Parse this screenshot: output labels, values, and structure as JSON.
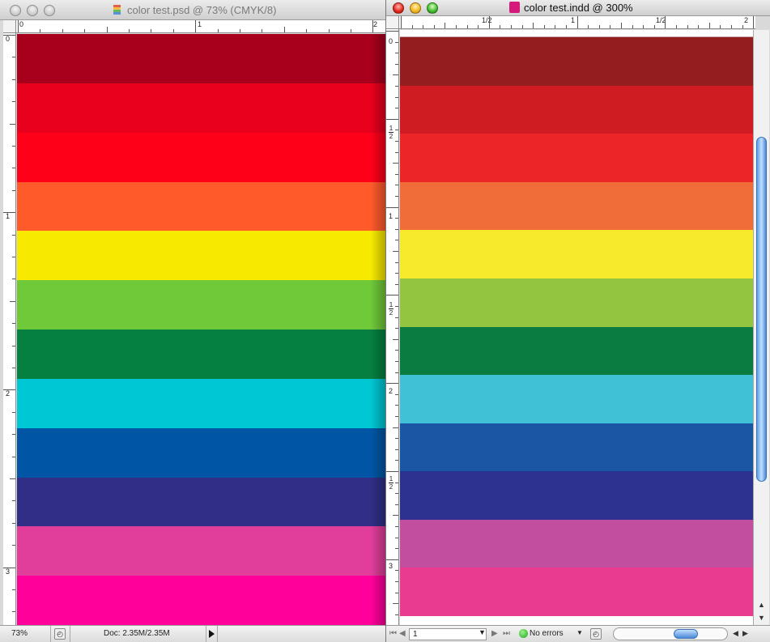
{
  "left_window": {
    "title": "color test.psd @ 73% (CMYK/8)",
    "ruler_h_labels": [
      "0",
      "1",
      "2"
    ],
    "ruler_v_labels": [
      "0",
      "1",
      "2",
      "3"
    ],
    "status": {
      "zoom": "73%",
      "doc_info": "Doc: 2.35M/2.35M"
    },
    "swatches": [
      "#a8001c",
      "#e8001c",
      "#ff0019",
      "#ff5a2a",
      "#f7ea00",
      "#6fc939",
      "#058040",
      "#00c7d4",
      "#0056a5",
      "#302e86",
      "#e03e9a",
      "#ff009a"
    ]
  },
  "right_window": {
    "title": "color test.indd @ 300%",
    "ruler_h_labels": [
      "1/2",
      "1",
      "1/2",
      "2"
    ],
    "ruler_v_labels": [
      "0",
      "1",
      "2",
      "3"
    ],
    "status": {
      "page": "1",
      "preflight": "No errors"
    },
    "swatches": [
      "#941d20",
      "#cf1c23",
      "#ec2528",
      "#f06c38",
      "#f7e92b",
      "#94c540",
      "#0b7c41",
      "#40c1d5",
      "#1b56a5",
      "#2d3190",
      "#c24e9f",
      "#e93b8f"
    ]
  }
}
